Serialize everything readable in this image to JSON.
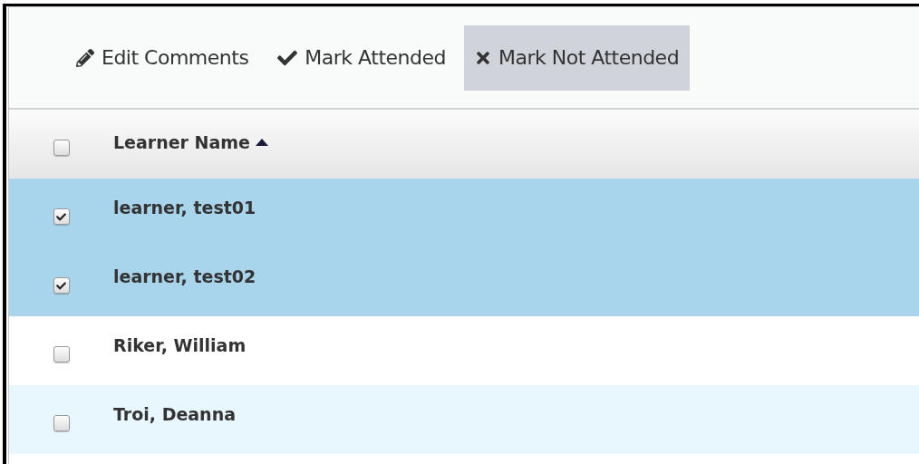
{
  "toolbar": [
    {
      "kind": "edit",
      "label": "Edit Comments",
      "highlighted": false
    },
    {
      "kind": "check",
      "label": "Mark Attended",
      "highlighted": false
    },
    {
      "kind": "close",
      "label": "Mark Not Attended",
      "highlighted": true
    }
  ],
  "table": {
    "header": {
      "checked": false,
      "label": "Learner Name",
      "sort_ascending": true
    },
    "rows": [
      {
        "name": "learner, test01",
        "selected": true
      },
      {
        "name": "learner, test02",
        "selected": true
      },
      {
        "name": "Riker, William",
        "selected": false
      },
      {
        "name": "Troi, Deanna",
        "selected": false
      }
    ]
  }
}
